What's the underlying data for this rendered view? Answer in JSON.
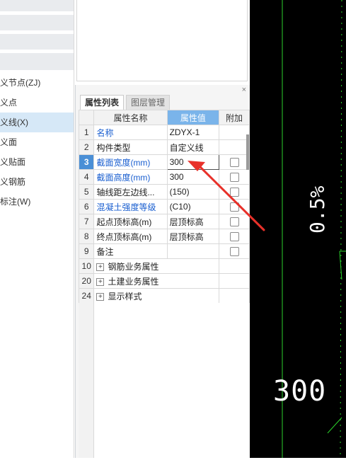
{
  "left_nav": {
    "items": [
      {
        "label": "义节点(ZJ)",
        "selected": false
      },
      {
        "label": "义点",
        "selected": false
      },
      {
        "label": "义线(X)",
        "selected": true
      },
      {
        "label": "义面",
        "selected": false
      },
      {
        "label": "义贴面",
        "selected": false
      },
      {
        "label": "义钢筋",
        "selected": false
      },
      {
        "label": "标注(W)",
        "selected": false
      }
    ]
  },
  "panel": {
    "close_icon": "×",
    "tabs": [
      {
        "label": "属性列表",
        "active": true
      },
      {
        "label": "图层管理",
        "active": false
      }
    ],
    "columns": {
      "name": "属性名称",
      "value": "属性值",
      "extra": "附加"
    },
    "rows": [
      {
        "num": "1",
        "name": "名称",
        "value": "ZDYX-1",
        "blue": true,
        "checkbox": false
      },
      {
        "num": "2",
        "name": "构件类型",
        "value": "自定义线",
        "blue": false,
        "checkbox": false
      },
      {
        "num": "3",
        "name": "截面宽度(mm)",
        "value": "300",
        "blue": true,
        "checkbox": true
      },
      {
        "num": "4",
        "name": "截面高度(mm)",
        "value": "300",
        "blue": true,
        "checkbox": true
      },
      {
        "num": "5",
        "name": "轴线距左边线...",
        "value": "(150)",
        "blue": false,
        "checkbox": true
      },
      {
        "num": "6",
        "name": "混凝土强度等级",
        "value": "(C10)",
        "blue": true,
        "checkbox": true
      },
      {
        "num": "7",
        "name": "起点顶标高(m)",
        "value": "层顶标高",
        "blue": false,
        "checkbox": true
      },
      {
        "num": "8",
        "name": "终点顶标高(m)",
        "value": "层顶标高",
        "blue": false,
        "checkbox": true
      },
      {
        "num": "9",
        "name": "备注",
        "value": "",
        "blue": false,
        "checkbox": true
      }
    ],
    "groups": [
      {
        "num": "10",
        "label": "钢筋业务属性"
      },
      {
        "num": "20",
        "label": "土建业务属性"
      },
      {
        "num": "24",
        "label": "显示样式"
      }
    ]
  },
  "canvas": {
    "dimension_text": "300",
    "slope_text": "0.5%",
    "line_color": "#2bd12b",
    "background": "#000000"
  },
  "annotation": {
    "arrow_color": "#e8312a"
  }
}
